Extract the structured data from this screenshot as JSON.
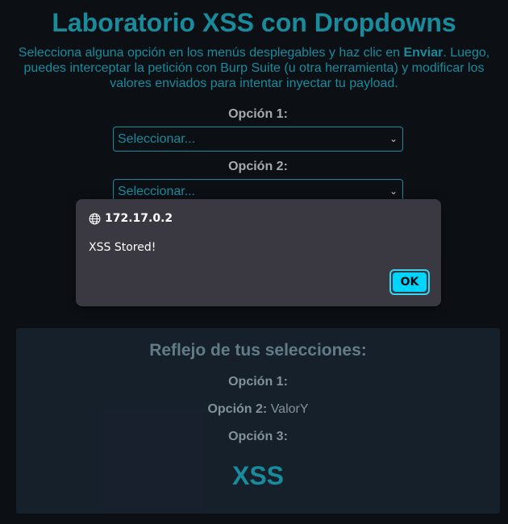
{
  "page": {
    "title": "Laboratorio XSS con Dropdowns",
    "intro_before": "Selecciona alguna opción en los menús desplegables y haz clic en ",
    "intro_strong": "Enviar",
    "intro_after": ". Luego, puedes interceptar la petición con Burp Suite (u otra herramienta) y modificar los valores enviados para intentar inyectar tu payload."
  },
  "form": {
    "option1_label": "Opción 1:",
    "option1_value": "Seleccionar...",
    "option2_label": "Opción 2:",
    "option2_value": "Seleccionar..."
  },
  "reflection": {
    "title": "Reflejo de tus selecciones:",
    "option1_label": "Opción 1:",
    "option1_value": "",
    "option2_label": "Opción 2:",
    "option2_value": "ValorY",
    "option3_label": "Opción 3:",
    "option3_value": "",
    "injected_heading": "XSS"
  },
  "alert": {
    "origin": "172.17.0.2",
    "message": "XSS Stored!",
    "ok_label": "OK",
    "icon": "globe-icon"
  },
  "colors": {
    "background": "#0d1117",
    "accent": "#1a93a6",
    "panel": "#18222e",
    "dialog": "#3a3941",
    "ok_button": "#00d5ff"
  }
}
